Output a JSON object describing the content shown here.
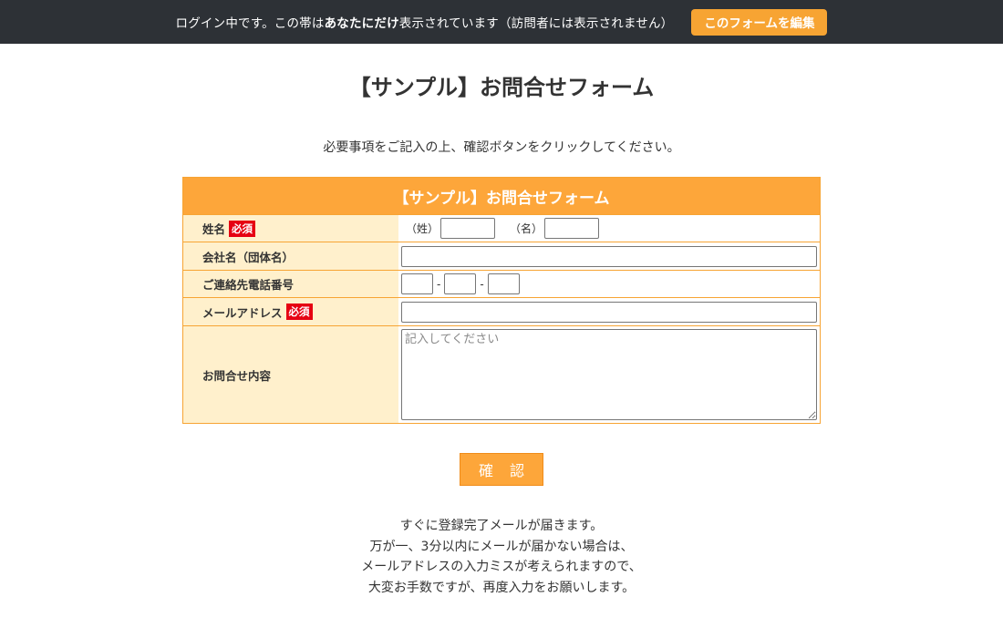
{
  "admin_bar": {
    "notice_prefix": "ログイン中です。この帯は",
    "notice_bold": "あなたにだけ",
    "notice_suffix": "表示されています（訪問者には表示されません）",
    "edit_button": "このフォームを編集"
  },
  "page": {
    "title": "【サンプル】お問合せフォーム",
    "intro": "必要事項をご記入の上、確認ボタンをクリックしてください。"
  },
  "form": {
    "header": "【サンプル】お問合せフォーム",
    "required_badge": "必須",
    "rows": {
      "name": {
        "label": "姓名",
        "last_label": "（姓）",
        "first_label": "（名）",
        "last_value": "",
        "first_value": ""
      },
      "company": {
        "label": "会社名（団体名）",
        "value": ""
      },
      "phone": {
        "label": "ご連絡先電話番号",
        "separator": "-",
        "part1": "",
        "part2": "",
        "part3": ""
      },
      "email": {
        "label": "メールアドレス",
        "value": ""
      },
      "message": {
        "label": "お問合せ内容",
        "placeholder": "記入してください",
        "value": ""
      }
    },
    "confirm_button": "確認"
  },
  "footer": {
    "lines": [
      "すぐに登録完了メールが届きます。",
      "万が一、3分以内にメールが届かない場合は、",
      "メールアドレスの入力ミスが考えられますので、",
      "大変お手数ですが、再度入力をお願いします。"
    ]
  },
  "colors": {
    "admin_bar_bg": "#2d3136",
    "accent_orange": "#fda63a",
    "label_bg": "#fff0cc",
    "required_red": "#e60012"
  }
}
